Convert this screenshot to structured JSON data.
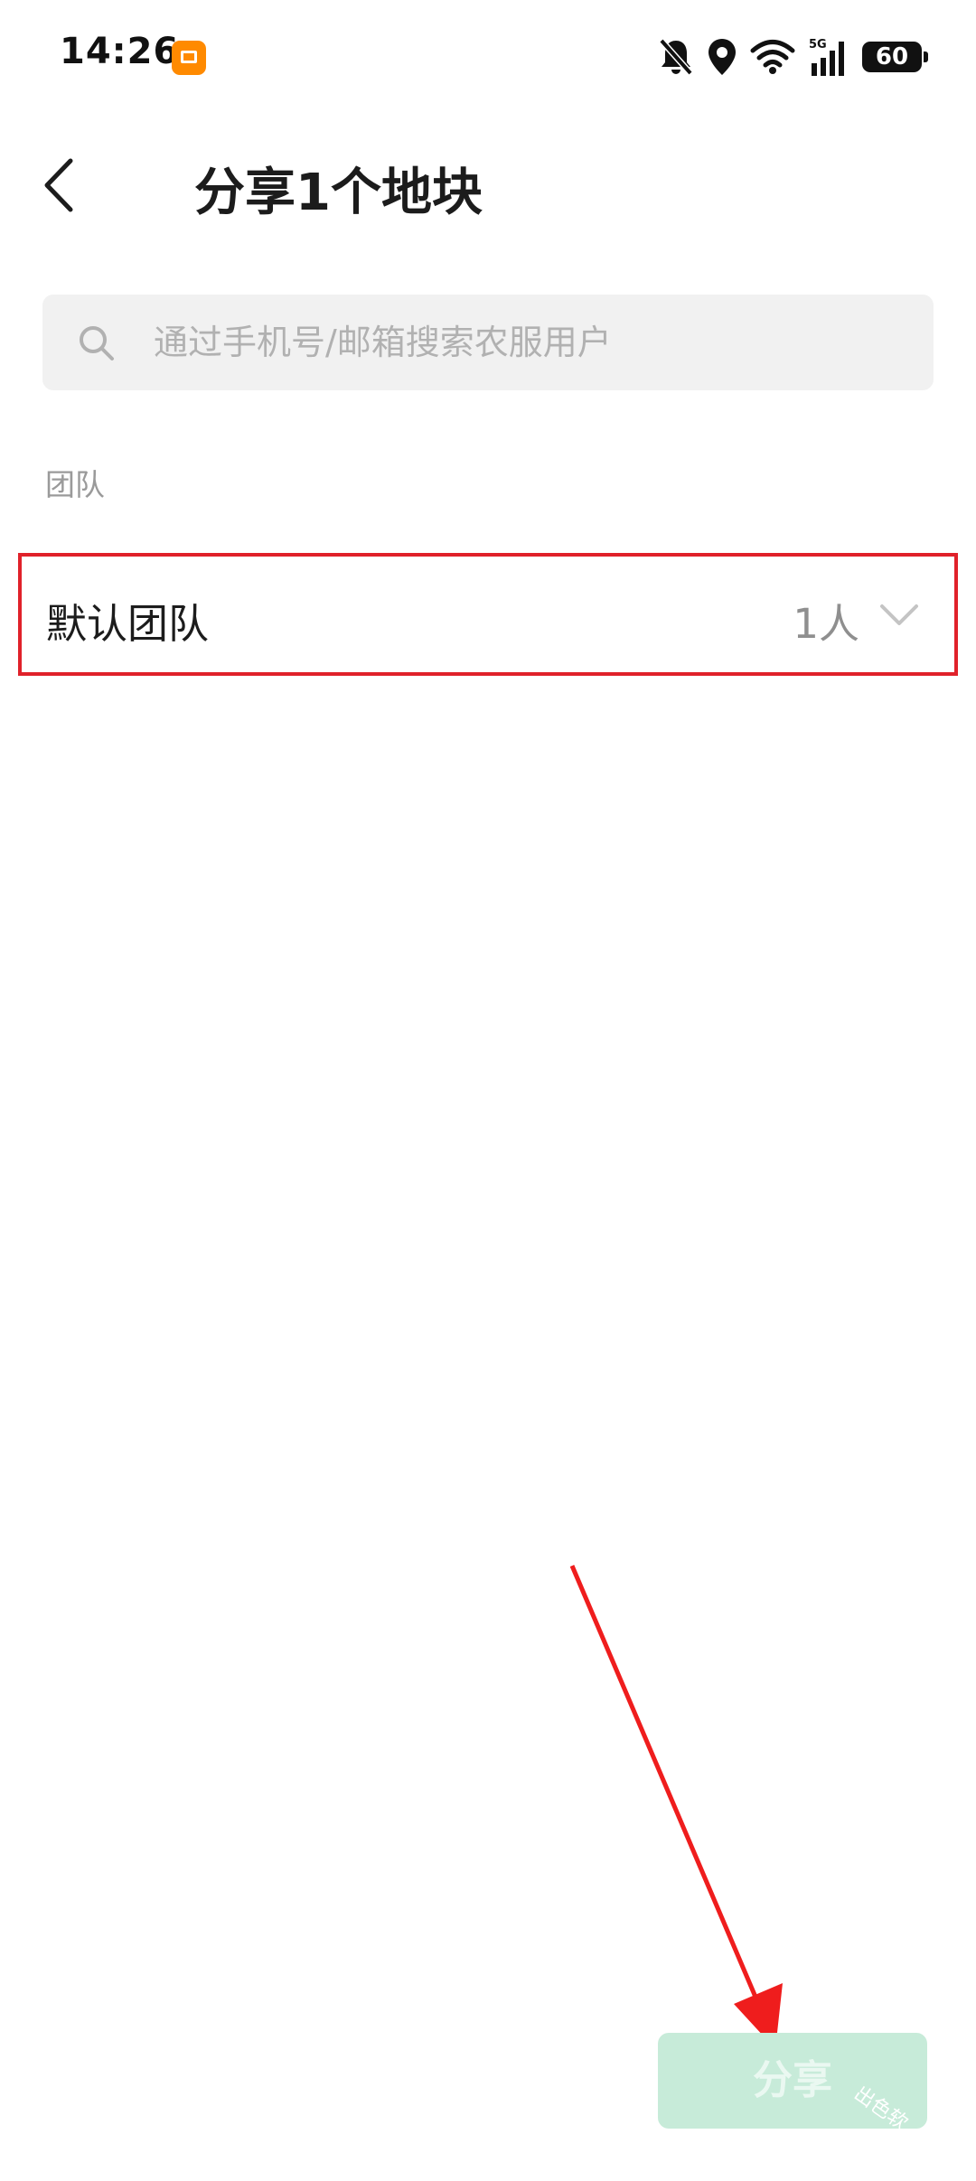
{
  "status_bar": {
    "time": "14:26",
    "network": "5G",
    "battery": "60",
    "icons": [
      "notification-app-icon",
      "bell-off-icon",
      "location-icon",
      "wifi-icon",
      "signal-icon",
      "battery-icon"
    ]
  },
  "header": {
    "title": "分享1个地块",
    "back_icon": "chevron-left-icon"
  },
  "search": {
    "placeholder": "通过手机号/邮箱搜索农服用户",
    "value": "",
    "icon": "search-icon"
  },
  "teams": {
    "section_label": "团队",
    "items": [
      {
        "name": "默认团队",
        "count": "1人",
        "expanded": false,
        "highlighted": true
      }
    ]
  },
  "footer": {
    "share_label": "分享",
    "share_enabled": false
  },
  "watermark": "出色软",
  "colors": {
    "accent": "#c7ebd9",
    "highlight": "#e0212a",
    "background": "#ffffff",
    "search_bg": "#f1f1f1",
    "muted_text": "#9a9a9a"
  }
}
